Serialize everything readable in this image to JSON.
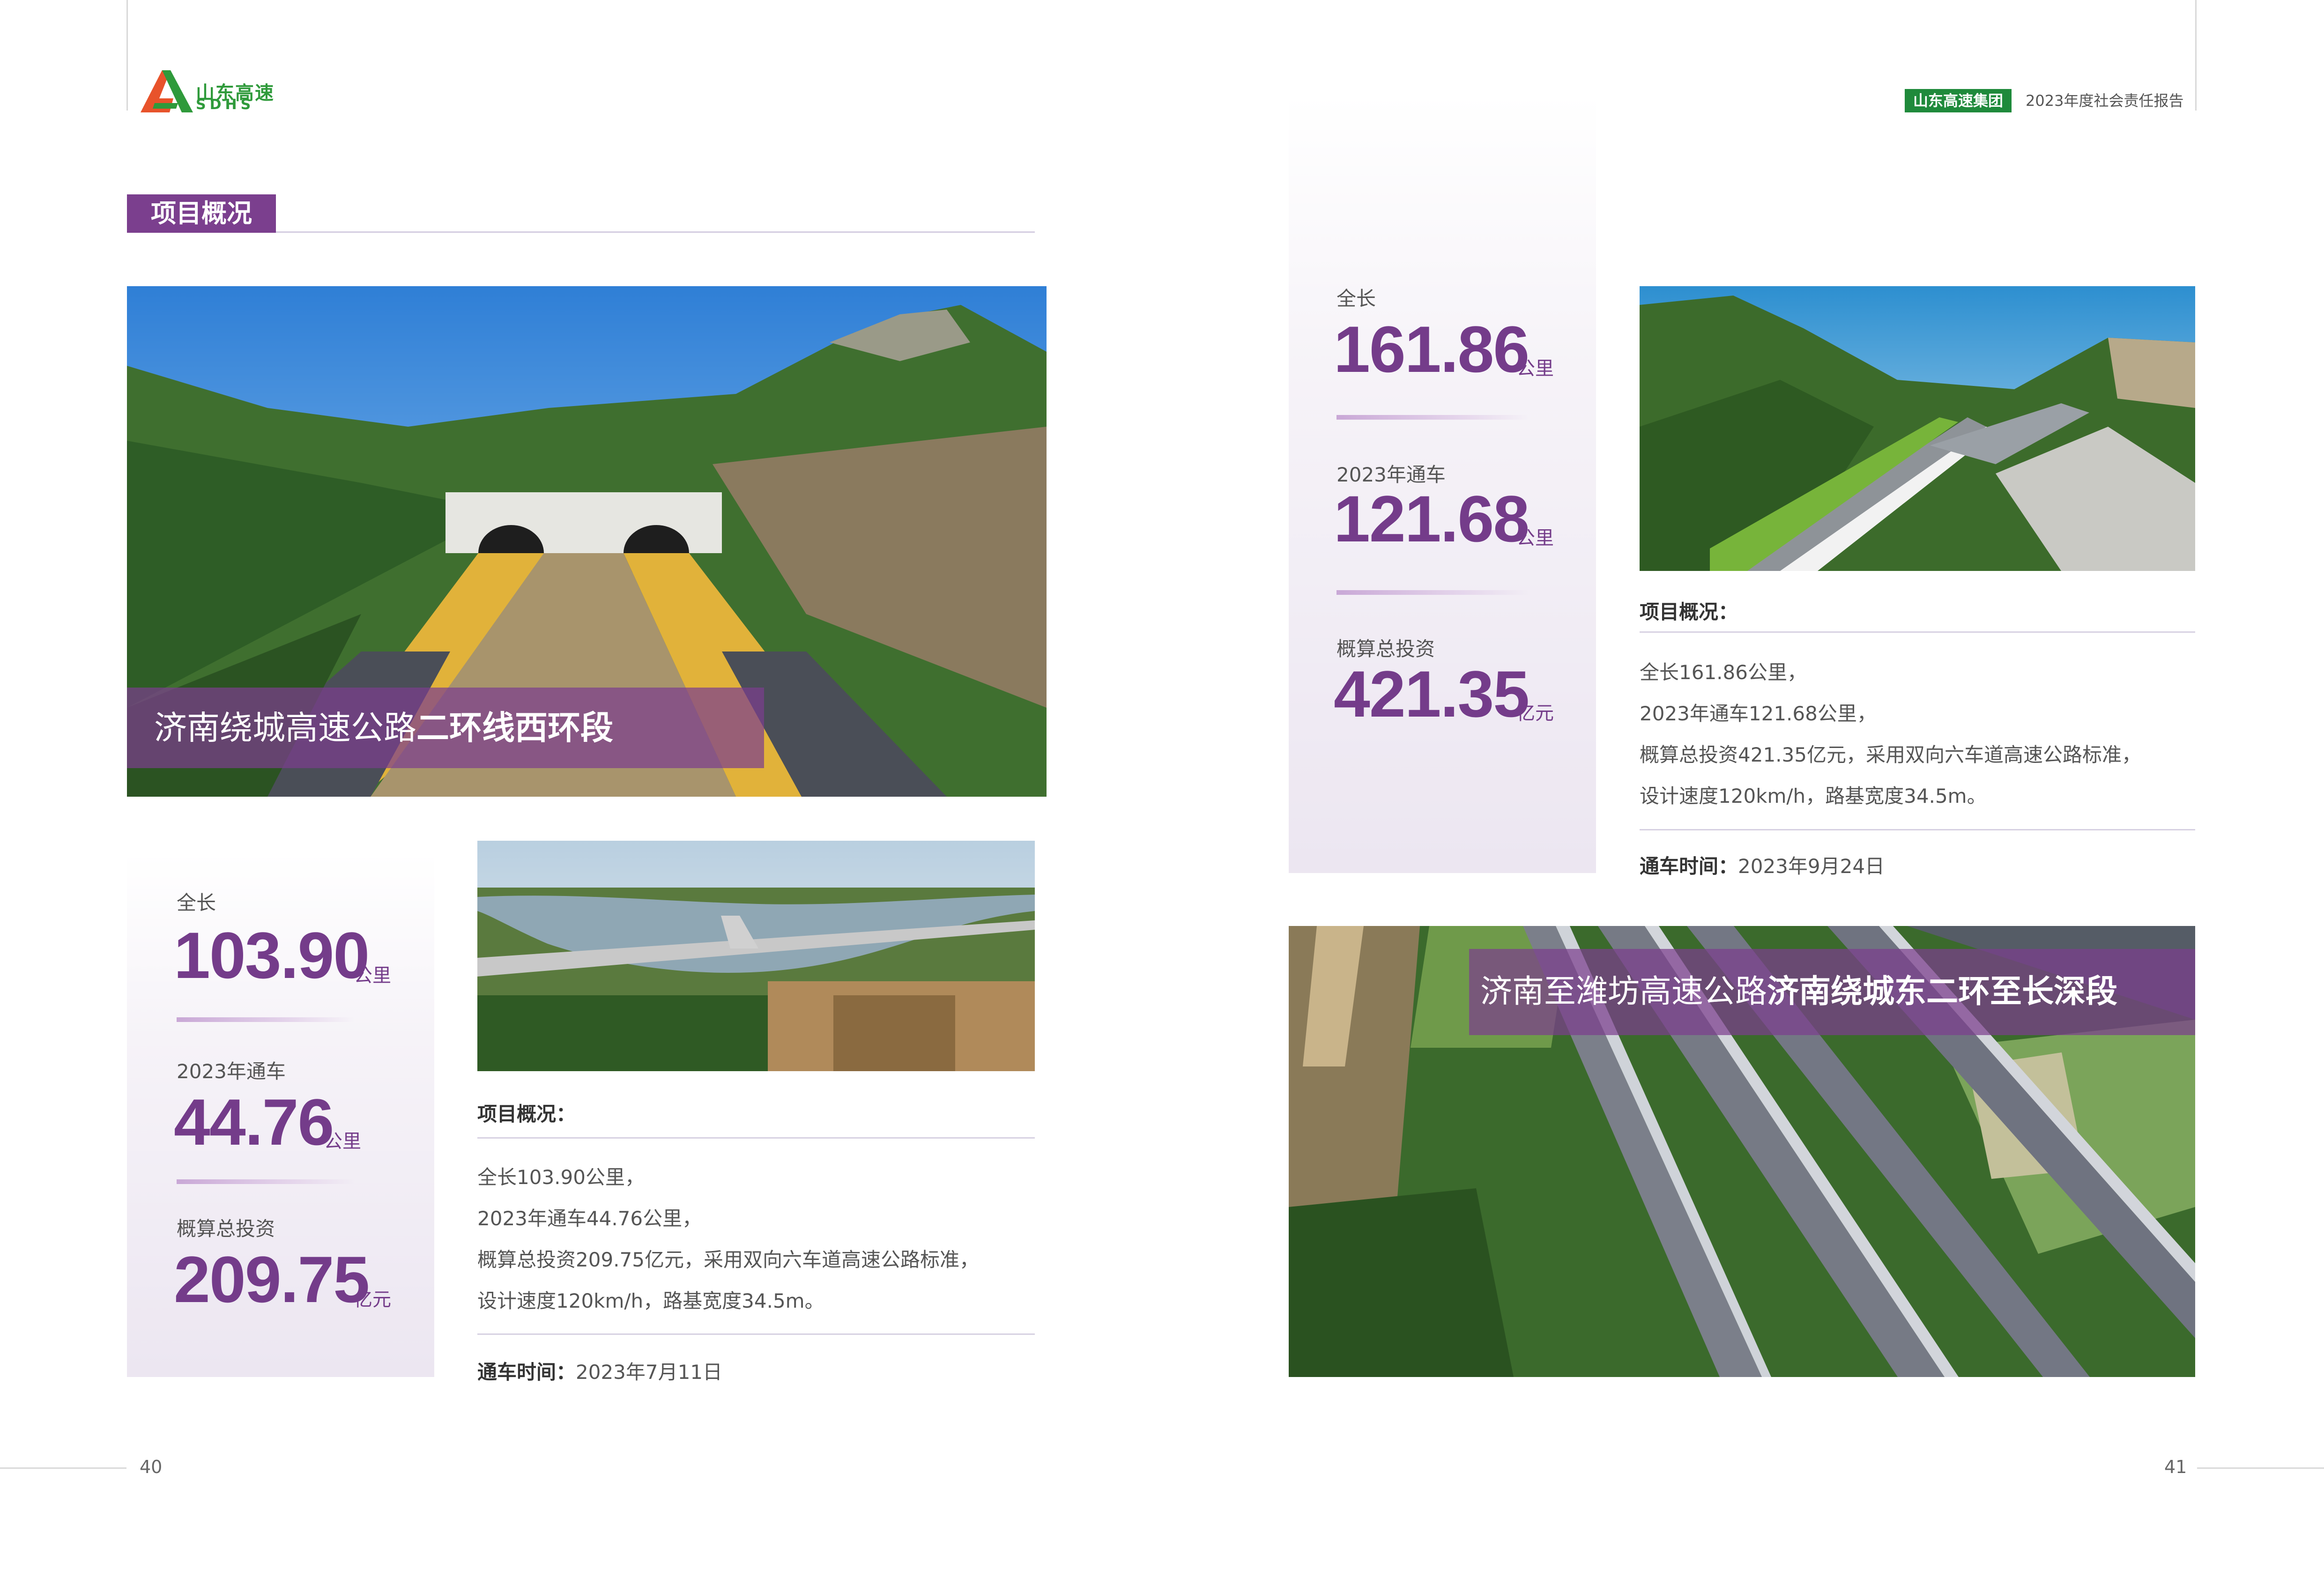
{
  "header": {
    "logo_cn": "山东高速",
    "logo_en": "SDHS",
    "group_badge": "山东高速集团",
    "report_title": "2023年度社会责任报告"
  },
  "section": {
    "title": "项目概况"
  },
  "project_west": {
    "banner_normal": "济南绕城高速公路",
    "banner_bold": "二环线西环段",
    "stats": [
      {
        "label": "全长",
        "value": "103.90",
        "unit": "公里"
      },
      {
        "label": "2023年通车",
        "value": "44.76",
        "unit": "公里"
      },
      {
        "label": "概算总投资",
        "value": "209.75",
        "unit": "亿元"
      }
    ],
    "overview_heading": "项目概况：",
    "overview_lines": [
      "全长103.90公里，",
      "2023年通车44.76公里，",
      "概算总投资209.75亿元，采用双向六车道高速公路标准，",
      "设计速度120km/h，路基宽度34.5m。"
    ],
    "open_label": "通车时间：",
    "open_date": "2023年7月11日"
  },
  "project_east": {
    "banner_normal": "济南至潍坊高速公路",
    "banner_bold": "济南绕城东二环至长深段",
    "stats": [
      {
        "label": "全长",
        "value": "161.86",
        "unit": "公里"
      },
      {
        "label": "2023年通车",
        "value": "121.68",
        "unit": "公里"
      },
      {
        "label": "概算总投资",
        "value": "421.35",
        "unit": "亿元"
      }
    ],
    "overview_heading": "项目概况：",
    "overview_lines": [
      "全长161.86公里，",
      "2023年通车121.68公里，",
      "概算总投资421.35亿元，采用双向六车道高速公路标准，",
      "设计速度120km/h，路基宽度34.5m。"
    ],
    "open_label": "通车时间：",
    "open_date": "2023年9月24日"
  },
  "footer": {
    "page_left": "40",
    "page_right": "41"
  },
  "colors": {
    "purple": "#7b3f8e",
    "green": "#1f8a3b",
    "accent_orange": "#e8532b"
  }
}
